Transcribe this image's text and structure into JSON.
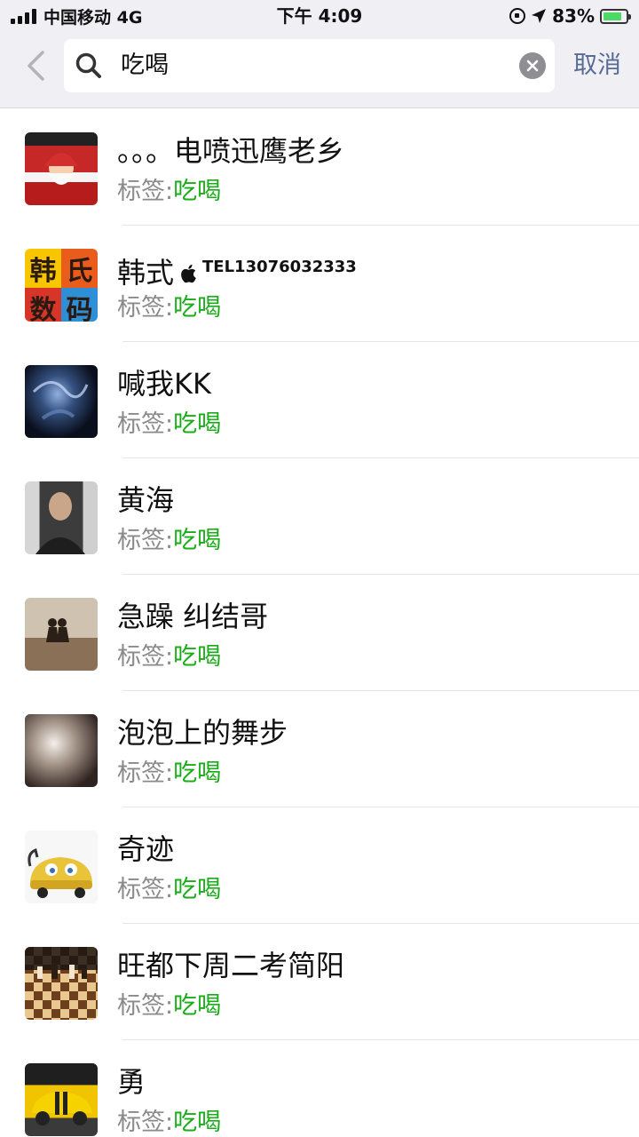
{
  "status_bar": {
    "carrier": "中国移动 4G",
    "time": "下午 4:09",
    "battery_percent": "83%",
    "battery_level": 0.83,
    "icons": [
      "signal-icon",
      "rotation-lock-icon",
      "location-icon",
      "battery-charging-icon"
    ]
  },
  "search": {
    "query": "吃喝",
    "cancel_label": "取消",
    "icons": [
      "back-chevron-icon",
      "search-icon",
      "clear-icon"
    ]
  },
  "results": [
    {
      "name": "。。。电喷迅鹰老乡",
      "tag_label": "标签:",
      "tag_value": "吃喝"
    },
    {
      "name": "韩式",
      "name_extra": "TEL13076032333",
      "name_icon": "apple-logo-icon",
      "tag_label": "标签:",
      "tag_value": "吃喝",
      "avatar_text": [
        "韩",
        "氏",
        "数",
        "码"
      ]
    },
    {
      "name": "喊我KK",
      "tag_label": "标签:",
      "tag_value": "吃喝"
    },
    {
      "name": "黄海",
      "tag_label": "标签:",
      "tag_value": "吃喝"
    },
    {
      "name": "急躁 纠结哥",
      "tag_label": "标签:",
      "tag_value": "吃喝"
    },
    {
      "name": "泡泡上的舞步",
      "tag_label": "标签:",
      "tag_value": "吃喝"
    },
    {
      "name": "奇迹",
      "tag_label": "标签:",
      "tag_value": "吃喝"
    },
    {
      "name": "旺都下周二考简阳",
      "tag_label": "标签:",
      "tag_value": "吃喝"
    },
    {
      "name": "勇",
      "tag_label": "标签:",
      "tag_value": "吃喝"
    }
  ],
  "colors": {
    "header_bg": "#efeff4",
    "tag_value": "#1aad19",
    "tag_label": "#8a8a8a",
    "cancel": "#576b95",
    "battery": "#4cd964"
  }
}
